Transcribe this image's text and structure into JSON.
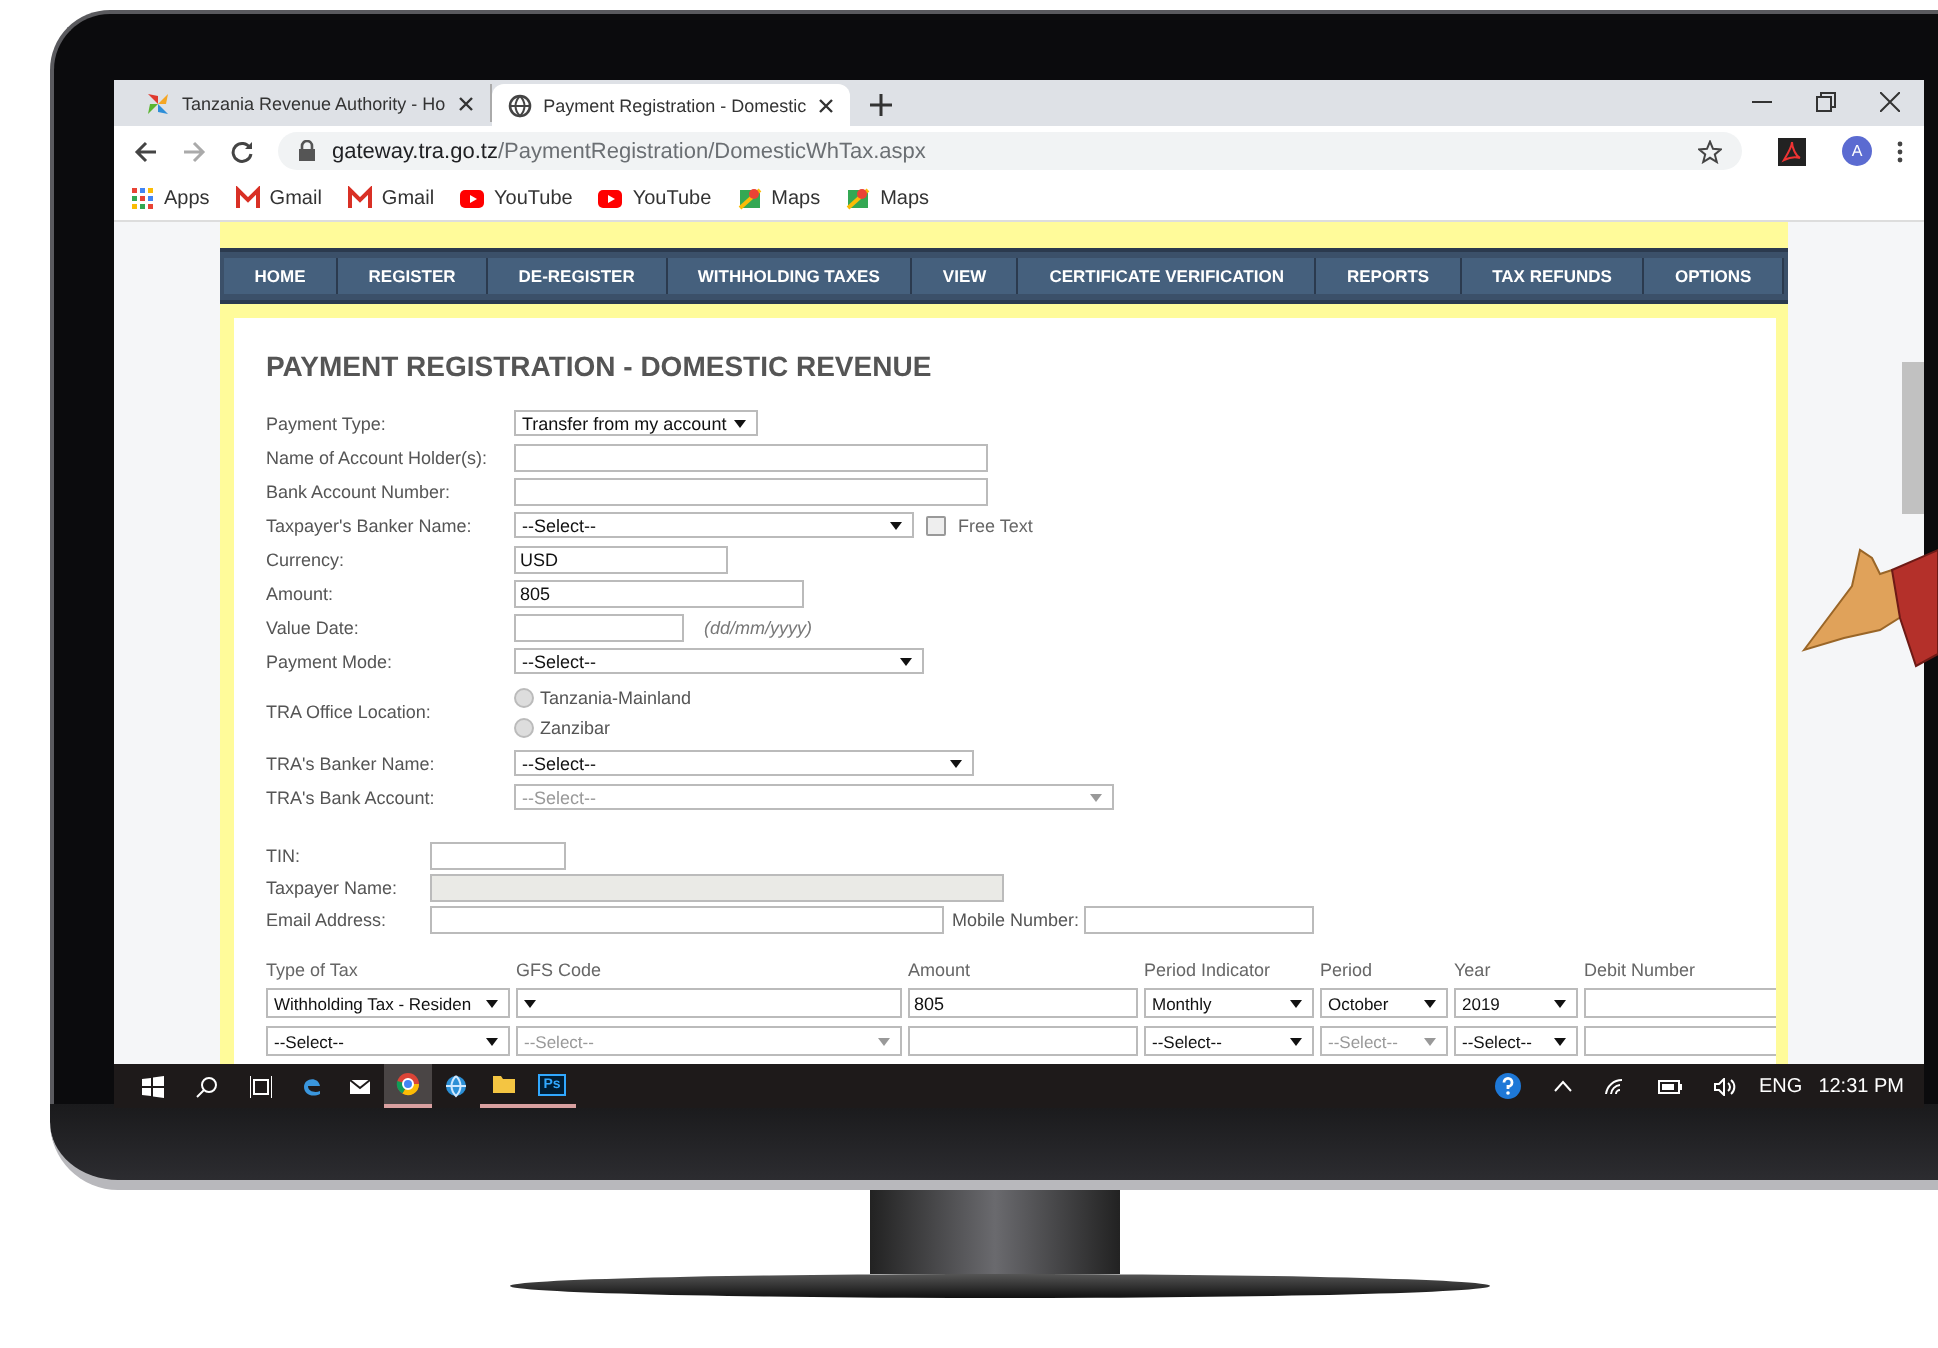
{
  "browser": {
    "tabs": [
      {
        "title": "Tanzania Revenue Authority - Ho",
        "kind": "pinwheel",
        "selected": false
      },
      {
        "title": "Payment Registration - Domestic",
        "kind": "globe",
        "selected": true
      }
    ],
    "url": "gateway.tra.go.tz/PaymentRegistration/DomesticWhTax.aspx",
    "profile": "A",
    "bookmarks": [
      {
        "label": "Apps",
        "kind": "apps"
      },
      {
        "label": "Gmail",
        "kind": "gmail"
      },
      {
        "label": "Gmail",
        "kind": "gmail"
      },
      {
        "label": "YouTube",
        "kind": "youtube"
      },
      {
        "label": "YouTube",
        "kind": "youtube"
      },
      {
        "label": "Maps",
        "kind": "maps"
      },
      {
        "label": "Maps",
        "kind": "maps"
      }
    ]
  },
  "nav": [
    "HOME",
    "REGISTER",
    "DE-REGISTER",
    "WITHHOLDING TAXES",
    "VIEW",
    "CERTIFICATE VERIFICATION",
    "REPORTS",
    "TAX REFUNDS",
    "OPTIONS"
  ],
  "form": {
    "title": "PAYMENT REGISTRATION - DOMESTIC REVENUE",
    "fields": [
      {
        "label": "Payment Type:",
        "kind": "select",
        "value": "Transfer from my account"
      },
      {
        "label": "Name of Account Holder(s):",
        "kind": "text"
      },
      {
        "label": "Bank Account Number:",
        "kind": "text"
      },
      {
        "label": "Taxpayer's Banker Name:",
        "kind": "select",
        "value": "--Select--",
        "checkbox": {
          "label": "Free Text",
          "checked": false
        }
      },
      {
        "label": "Currency:",
        "kind": "text",
        "value": "USD"
      },
      {
        "label": "Amount:",
        "kind": "text",
        "value": "805"
      },
      {
        "label": "Value Date:",
        "kind": "text",
        "hint": "(dd/mm/yyyy)"
      },
      {
        "label": "Payment Mode:",
        "kind": "select",
        "value": "--Select--"
      },
      {
        "label": "TRA Office Location:",
        "kind": "radio",
        "options": [
          {
            "label": "Tanzania-Mainland",
            "selected": false
          },
          {
            "label": "Zanzibar",
            "selected": false
          }
        ]
      },
      {
        "label": "TRA's Banker Name:",
        "kind": "select",
        "value": "--Select--"
      },
      {
        "label": "TRA's Bank Account:",
        "kind": "select",
        "value": "--Select--",
        "disabled": true
      }
    ],
    "taxpayer": [
      {
        "label": "TIN:"
      },
      {
        "label": "Taxpayer Name:",
        "disabled": true
      },
      {
        "label": "Email Address:",
        "extra": {
          "label": "Mobile Number:"
        }
      }
    ],
    "tax_table": {
      "columns": [
        "Type of Tax",
        "GFS Code",
        "Amount",
        "Period Indicator",
        "Period",
        "Year",
        "Debit Number"
      ],
      "rows": [
        [
          {
            "kind": "select",
            "value": "Withholding Tax - Residen"
          },
          {
            "kind": "select"
          },
          {
            "kind": "input",
            "value": "805"
          },
          {
            "kind": "select",
            "value": "Monthly"
          },
          {
            "kind": "select",
            "value": "October"
          },
          {
            "kind": "select",
            "value": "2019"
          },
          {
            "kind": "input"
          }
        ],
        [
          {
            "kind": "select",
            "value": "--Select--"
          },
          {
            "kind": "select",
            "value": "--Select--",
            "disabled": true
          },
          {
            "kind": "input"
          },
          {
            "kind": "select",
            "value": "--Select--"
          },
          {
            "kind": "select",
            "value": "--Select--",
            "disabled": true
          },
          {
            "kind": "select",
            "value": "--Select--"
          },
          {
            "kind": "input"
          }
        ]
      ]
    }
  },
  "taskbar": {
    "apps": [
      {
        "kind": "edge",
        "running": false,
        "active": false
      },
      {
        "kind": "mail",
        "running": false,
        "active": false
      },
      {
        "kind": "chrome",
        "running": true,
        "active": true
      },
      {
        "kind": "globe",
        "running": false,
        "active": false
      },
      {
        "kind": "folder",
        "running": true,
        "active": false
      },
      {
        "kind": "photoshop",
        "label": "Ps",
        "running": true,
        "active": false
      }
    ],
    "language": "ENG",
    "time": "12:31 PM"
  }
}
